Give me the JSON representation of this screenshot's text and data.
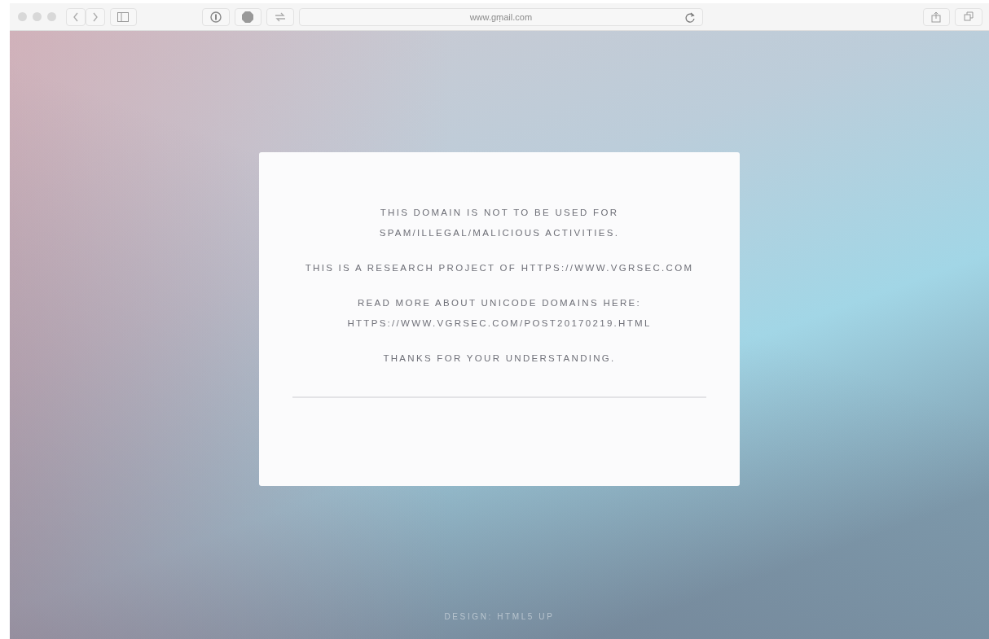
{
  "browser": {
    "url": "www.gṃail.com"
  },
  "notice": {
    "paragraphs": [
      {
        "lines": [
          "THIS DOMAIN IS NOT TO BE USED FOR",
          "SPAM/ILLEGAL/MALICIOUS ACTIVITIES."
        ]
      },
      {
        "lines": [
          "THIS IS A RESEARCH PROJECT OF HTTPS://WWW.VGRSEC.COM"
        ]
      },
      {
        "lines": [
          "READ MORE ABOUT UNICODE DOMAINS HERE:",
          "HTTPS://WWW.VGRSEC.COM/POST20170219.HTML"
        ]
      },
      {
        "lines": [
          "THANKS FOR YOUR UNDERSTANDING."
        ]
      }
    ]
  },
  "footer": {
    "credit": "DESIGN: HTML5 UP"
  }
}
